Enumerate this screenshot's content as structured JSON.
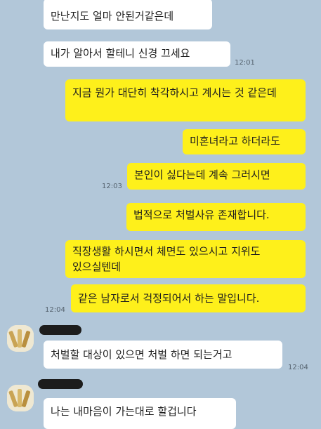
{
  "chat": {
    "messages": [
      {
        "side": "left",
        "text": "만난지도 얼마 안된거같은데"
      },
      {
        "side": "left",
        "text": "내가 알아서 할테니 신경 끄세요",
        "time": "12:01"
      },
      {
        "side": "right",
        "text": "지금 뭔가 대단히 착각하시고 계시는 것 같은데"
      },
      {
        "side": "right",
        "text": "미혼녀라고 하더라도"
      },
      {
        "side": "right",
        "text": "본인이 싫다는데 계속 그러시면",
        "time": "12:03"
      },
      {
        "side": "right",
        "text": "법적으로 처벌사유 존재합니다."
      },
      {
        "side": "right",
        "text": "직장생활 하시면서 체면도 있으시고 지위도 있으실텐데"
      },
      {
        "side": "right",
        "text": "같은 남자로서 걱정되어서 하는 말입니다.",
        "time": "12:04"
      },
      {
        "side": "left",
        "text": "처벌할 대상이 있으면 처벌 하면 되는거고",
        "time": "12:04"
      },
      {
        "side": "left",
        "text": "나는 내마음이 가는대로 할겁니다"
      }
    ]
  },
  "colors": {
    "background": "#b2c7d9",
    "sent_bubble": "#fef01b",
    "received_bubble": "#ffffff"
  },
  "icons": {
    "avatar": "profile-avatar-icon",
    "name_mask": "redacted-name"
  }
}
